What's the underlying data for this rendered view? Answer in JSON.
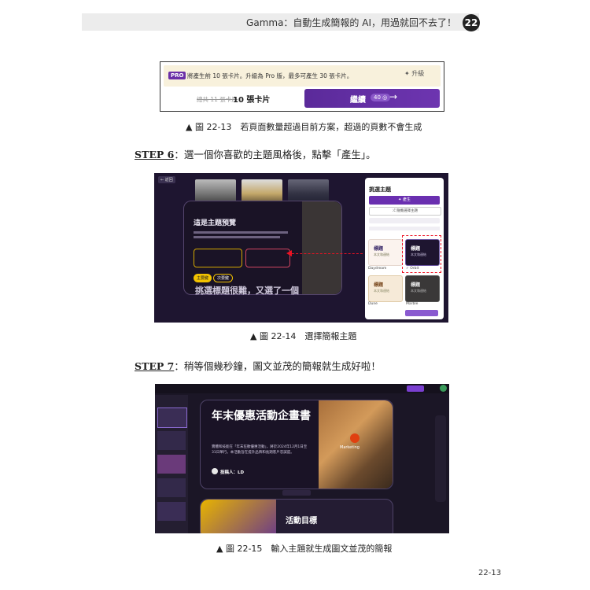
{
  "header": {
    "title": "Gamma：自動生成簡報的 AI，用過就回不去了！",
    "chapter": "22"
  },
  "fig13": {
    "pro_badge": "PRO",
    "pro_text": "將產生前 10 張卡片。升級為 Pro 版，最多可產生 30 張卡片。",
    "upgrade": "✦ 升級",
    "old_count": "總共 11 張卡片",
    "new_count": "10 張卡片",
    "continue": "繼續",
    "credits": "40 ◎",
    "arrow": "→"
  },
  "captions": {
    "fig13": "▲ 圖 22-13　若頁面數量超過目前方案，超過的頁數不會生成",
    "fig14": "▲ 圖 22-14　選擇簡報主題",
    "fig15": "▲ 圖 22-15　輸入主題就生成圖文並茂的簡報"
  },
  "steps": {
    "step6_label": "STEP 6",
    "step6_text": "：選一個你喜歡的主題風格後，點擊「產生」。",
    "step7_label": "STEP 7",
    "step7_text": "：稍等個幾秒鐘，圖文並茂的簡報就生成好啦！"
  },
  "fig14": {
    "back": "← 返回",
    "modal_title": "這是主題預覽",
    "panel_title": "挑選主題",
    "generate": "✦ 產生",
    "random": "⤮ 隨機選擇主題",
    "tile_heading": "標題",
    "tile_sub": "本文和連結",
    "theme1": "Daydream",
    "theme2": "✓ Orbit",
    "theme3": "Dune",
    "theme4": "Marble",
    "btn1": "主要鍵",
    "btn2": "次要鍵",
    "bg_heading": "挑選標題很難，又選了一個"
  },
  "fig15": {
    "slide_title": "年末優惠活動企畫書",
    "slide_body": "實體和技能在「年末狂歡優惠活動」，將於2024年12月1日至31日舉行。本活動旨在提升品牌和長期客戶忠誠度。",
    "author": "投稿人：LD",
    "photo_text": "Marketing",
    "slide2_title": "活動目標"
  },
  "page_number": "22-13"
}
